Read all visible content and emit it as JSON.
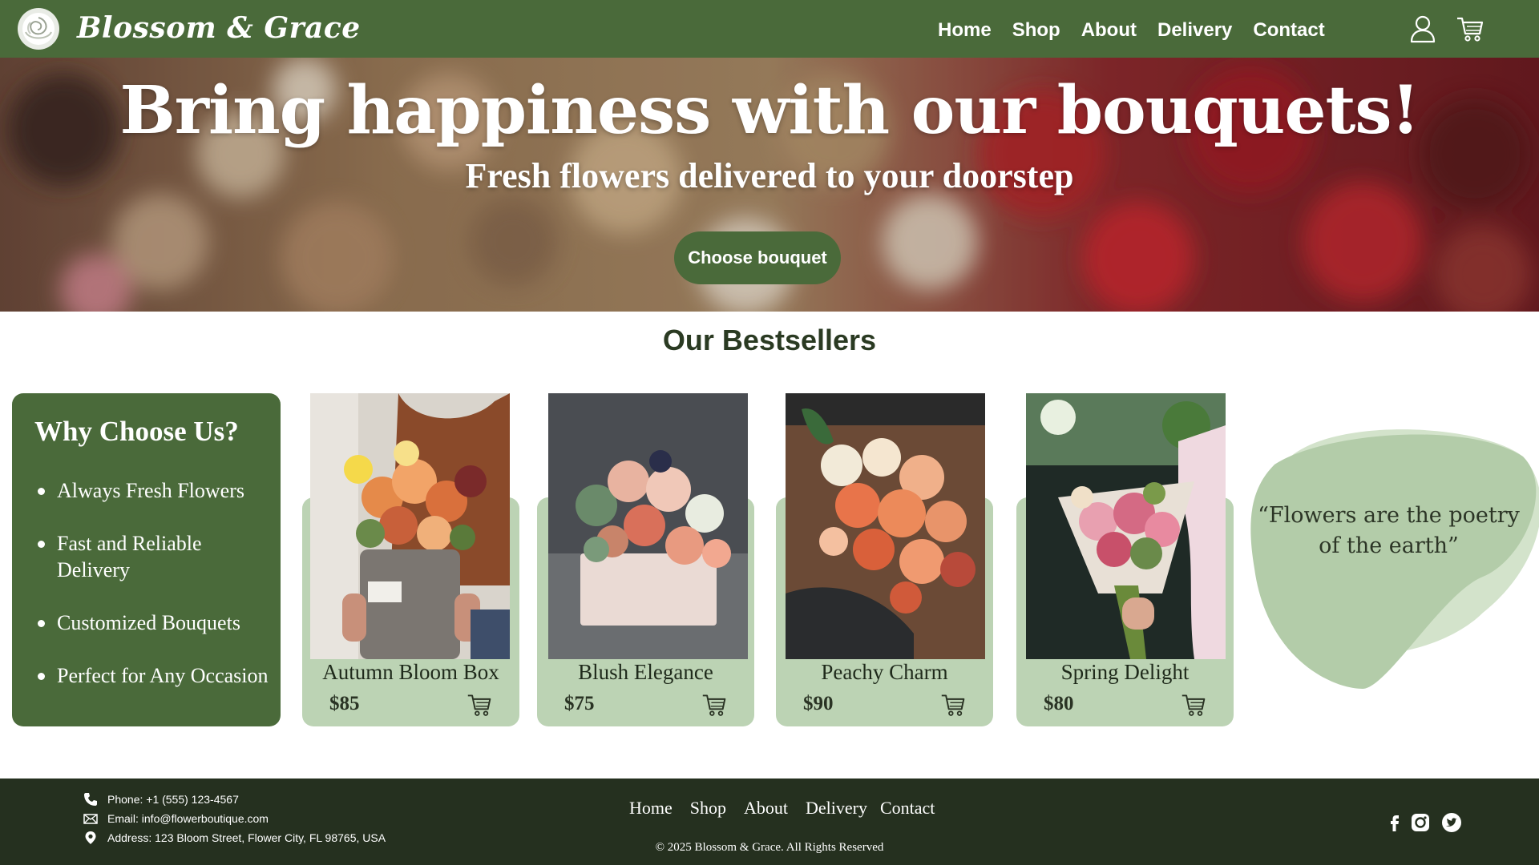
{
  "header": {
    "brand": "Blossom & Grace",
    "logo_icon": "rose-logo-icon",
    "nav": [
      "Home",
      "Shop",
      "About",
      "Delivery",
      "Contact"
    ],
    "account_icon": "user-icon",
    "cart_icon": "cart-icon"
  },
  "hero": {
    "title": "Bring happiness with our bouquets!",
    "subtitle": "Fresh flowers delivered to your doorstep",
    "cta_label": "Choose bouquet"
  },
  "bestsellers": {
    "title": "Our Bestsellers",
    "why_title": "Why Choose Us?",
    "why_items": [
      "Always Fresh Flowers",
      "Fast and Reliable Delivery",
      "Customized Bouquets",
      "Perfect for Any Occasion"
    ],
    "products": [
      {
        "name": "Autumn Bloom Box",
        "price": "$85"
      },
      {
        "name": "Blush Elegance",
        "price": "$75"
      },
      {
        "name": "Peachy Charm",
        "price": "$90"
      },
      {
        "name": "Spring Delight",
        "price": "$80"
      }
    ],
    "quote": "“Flowers are the poetry of the earth”"
  },
  "footer": {
    "phone": "Phone: +1 (555) 123-4567",
    "email": "Email: info@flowerboutique.com",
    "address": "Address: 123 Bloom Street, Flower City, FL 98765, USA",
    "nav": [
      "Home",
      "Shop",
      "About",
      "Delivery",
      "Contact"
    ],
    "copyright": "© 2025 Blossom & Grace. All Rights Reserved",
    "social_icons": [
      "facebook-icon",
      "instagram-icon",
      "twitter-icon"
    ]
  },
  "colors": {
    "brand_green": "#4a6a3a",
    "card_green": "#bcd3b4",
    "footer_dark": "#25301f",
    "quote_blob": "#b3cca9"
  }
}
